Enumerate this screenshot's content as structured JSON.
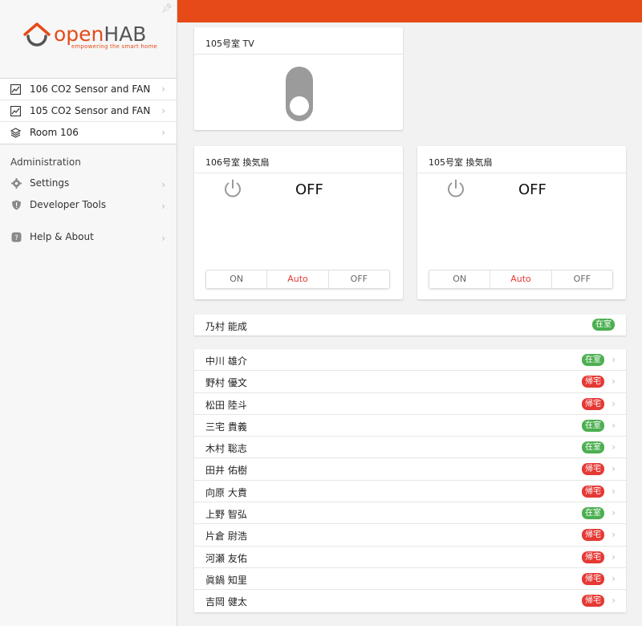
{
  "brand": {
    "name_o": "open",
    "name_h": "HAB",
    "tagline": "empowering the smart home",
    "accent": "#e64a19"
  },
  "sidebar": {
    "items": [
      {
        "label": "106 CO2 Sensor and FAN",
        "icon": "chart-icon"
      },
      {
        "label": "105 CO2 Sensor and FAN",
        "icon": "chart-icon"
      },
      {
        "label": "Room 106",
        "icon": "layers-icon"
      }
    ],
    "admin_title": "Administration",
    "admin_items": [
      {
        "label": "Settings",
        "icon": "gear-icon"
      },
      {
        "label": "Developer Tools",
        "icon": "shield-icon"
      },
      {
        "label": "Help & About",
        "icon": "help-icon"
      }
    ]
  },
  "cards": {
    "tv": {
      "title": "105号室 TV"
    },
    "fan106": {
      "title": "106号室 換気扇",
      "state": "OFF",
      "buttons": [
        "ON",
        "Auto",
        "OFF"
      ],
      "active": "Auto"
    },
    "fan105": {
      "title": "105号室 換気扇",
      "state": "OFF",
      "buttons": [
        "ON",
        "Auto",
        "OFF"
      ],
      "active": "Auto"
    }
  },
  "person_single": {
    "name": "乃村 能成",
    "status": "在室",
    "status_color": "green"
  },
  "persons": [
    {
      "name": "中川 雄介",
      "status": "在室",
      "status_color": "green"
    },
    {
      "name": "野村 優文",
      "status": "帰宅",
      "status_color": "red"
    },
    {
      "name": "松田 陸斗",
      "status": "帰宅",
      "status_color": "red"
    },
    {
      "name": "三宅 貴義",
      "status": "在室",
      "status_color": "green"
    },
    {
      "name": "木村 聡志",
      "status": "在室",
      "status_color": "green"
    },
    {
      "name": "田井 佑樹",
      "status": "帰宅",
      "status_color": "red"
    },
    {
      "name": "向原 大貴",
      "status": "帰宅",
      "status_color": "red"
    },
    {
      "name": "上野 智弘",
      "status": "在室",
      "status_color": "green"
    },
    {
      "name": "片倉 尉浩",
      "status": "帰宅",
      "status_color": "red"
    },
    {
      "name": "河瀬 友佑",
      "status": "帰宅",
      "status_color": "red"
    },
    {
      "name": "眞鍋 知里",
      "status": "帰宅",
      "status_color": "red"
    },
    {
      "name": "吉岡 健太",
      "status": "帰宅",
      "status_color": "red"
    }
  ]
}
